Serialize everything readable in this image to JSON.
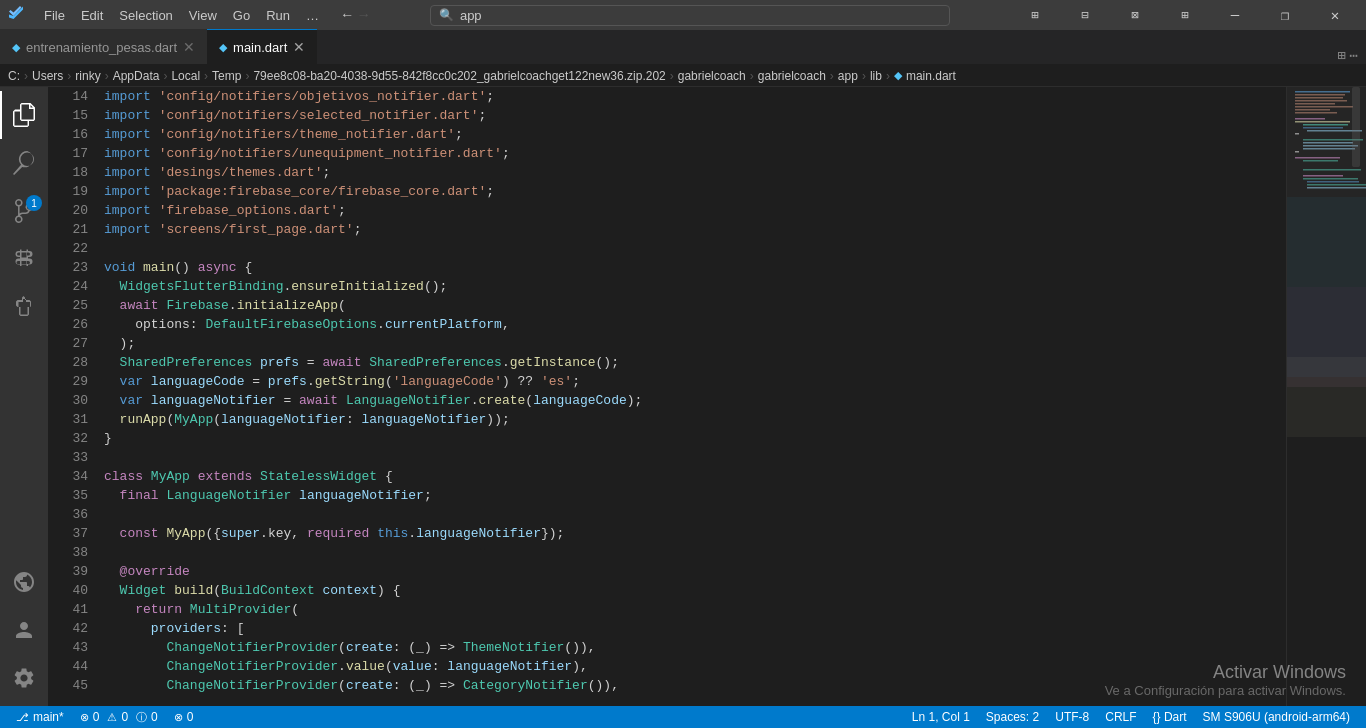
{
  "titleBar": {
    "menuItems": [
      "File",
      "Edit",
      "Selection",
      "View",
      "Go",
      "Run",
      "…"
    ],
    "searchPlaceholder": "app",
    "windowControls": [
      "minimize",
      "restore",
      "maximize-restore",
      "grid",
      "minimize-btn",
      "restore-btn",
      "close-btn"
    ]
  },
  "tabs": [
    {
      "id": "tab-entrenamiento",
      "label": "entrenamiento_pesas.dart",
      "active": false,
      "icon": "dart"
    },
    {
      "id": "tab-main",
      "label": "main.dart",
      "active": true,
      "icon": "dart"
    }
  ],
  "breadcrumb": {
    "parts": [
      "C:",
      "Users",
      "rinky",
      "AppData",
      "Local",
      "Temp",
      "79ee8c08-ba20-4038-9d55-842f8cc0c202_gabrielcoachget122new36.zip.202",
      "gabrielcoach",
      "gabrielcoach",
      "app",
      "lib",
      "main.dart"
    ]
  },
  "statusBar": {
    "left": [
      {
        "id": "branch",
        "text": "⎇ main*"
      },
      {
        "id": "errors",
        "text": "⊗ 0  ⚠ 0  ⓘ 0"
      },
      {
        "id": "warnings",
        "text": "⊗ 0"
      }
    ],
    "right": [
      {
        "id": "position",
        "text": "Ln 1, Col 1"
      },
      {
        "id": "spaces",
        "text": "Spaces: 2"
      },
      {
        "id": "encoding",
        "text": "UTF-8"
      },
      {
        "id": "line-ending",
        "text": "CRLF"
      },
      {
        "id": "language",
        "text": "{} Dart"
      },
      {
        "id": "device",
        "text": "SM S906U (android-arm64)"
      }
    ]
  },
  "activateWindows": {
    "title": "Activar Windows",
    "subtitle": "Ve a Configuración para activar Windows."
  },
  "lineNumbers": [
    14,
    15,
    16,
    17,
    18,
    19,
    20,
    21,
    22,
    23,
    24,
    25,
    26,
    27,
    28,
    29,
    30,
    31,
    32,
    33,
    34,
    35,
    36,
    37,
    38,
    39,
    40,
    41,
    42,
    43,
    44,
    45
  ],
  "code": {
    "lines": [
      "import 'config/notifiers/objetivos_notifier.dart';",
      "import 'config/notifiers/selected_notifier.dart';",
      "import 'config/notifiers/theme_notifier.dart';",
      "import 'config/notifiers/unequipment_notifier.dart';",
      "import 'desings/themes.dart';",
      "import 'package:firebase_core/firebase_core.dart';",
      "import 'firebase_options.dart';",
      "import 'screens/first_page.dart';",
      "",
      "void main() async {",
      "  WidgetsFlutterBinding.ensureInitialized();",
      "  await Firebase.initializeApp(",
      "    options: DefaultFirebaseOptions.currentPlatform,",
      "  );",
      "  SharedPreferences prefs = await SharedPreferences.getInstance();",
      "  var languageCode = prefs.getString('languageCode') ?? 'es';",
      "  var languageNotifier = await LanguageNotifier.create(languageCode);",
      "  runApp(MyApp(languageNotifier: languageNotifier));",
      "}",
      "",
      "class MyApp extends StatelessWidget {",
      "  final LanguageNotifier languageNotifier;",
      "",
      "  const MyApp({super.key, required this.languageNotifier});",
      "",
      "  @override",
      "  Widget build(BuildContext context) {",
      "    return MultiProvider(",
      "      providers: [",
      "        ChangeNotifierProvider(create: (_) => ThemeNotifier()),",
      "        ChangeNotifierProvider.value(value: languageNotifier),",
      "        ChangeNotifierProvider(create: (_) => CategoryNotifier()),"
    ]
  }
}
